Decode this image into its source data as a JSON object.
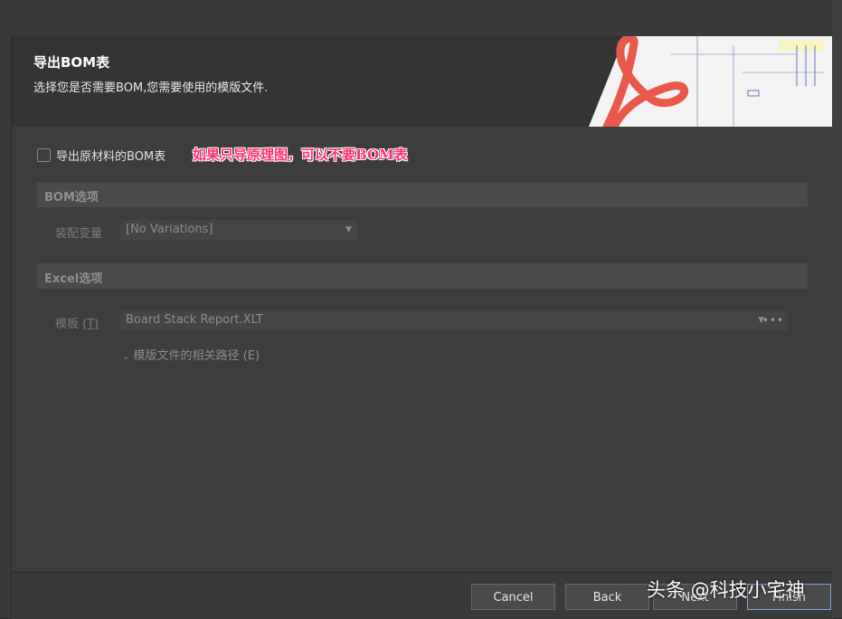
{
  "header": {
    "title": "导出BOM表",
    "subtitle": "选择您是否需要BOM,您需要使用的模版文件."
  },
  "export_bom": {
    "checkbox_label": "导出原材料的BOM表",
    "checked": false
  },
  "annotation": "如果只导原理图，可以不要BOM表",
  "bom_options": {
    "section_title": "BOM选项",
    "variant_label": "装配变量",
    "variant_value": "[No Variations]"
  },
  "excel_options": {
    "section_title": "Excel选项",
    "template_label": "模板",
    "template_hotkey": "(T)",
    "template_value": "Board Stack Report.XLT",
    "relative_path_label": "模版文件的相关路径",
    "relative_path_hotkey": "(E)"
  },
  "footer": {
    "cancel": "Cancel",
    "back": "Back",
    "next": "Next",
    "finish": "Finish"
  },
  "watermark": "头条 @科技小宅神",
  "colors": {
    "accent_red": "#e8594a",
    "annotation_pink": "#ff2f6e",
    "finish_border": "#7fa7d8"
  }
}
